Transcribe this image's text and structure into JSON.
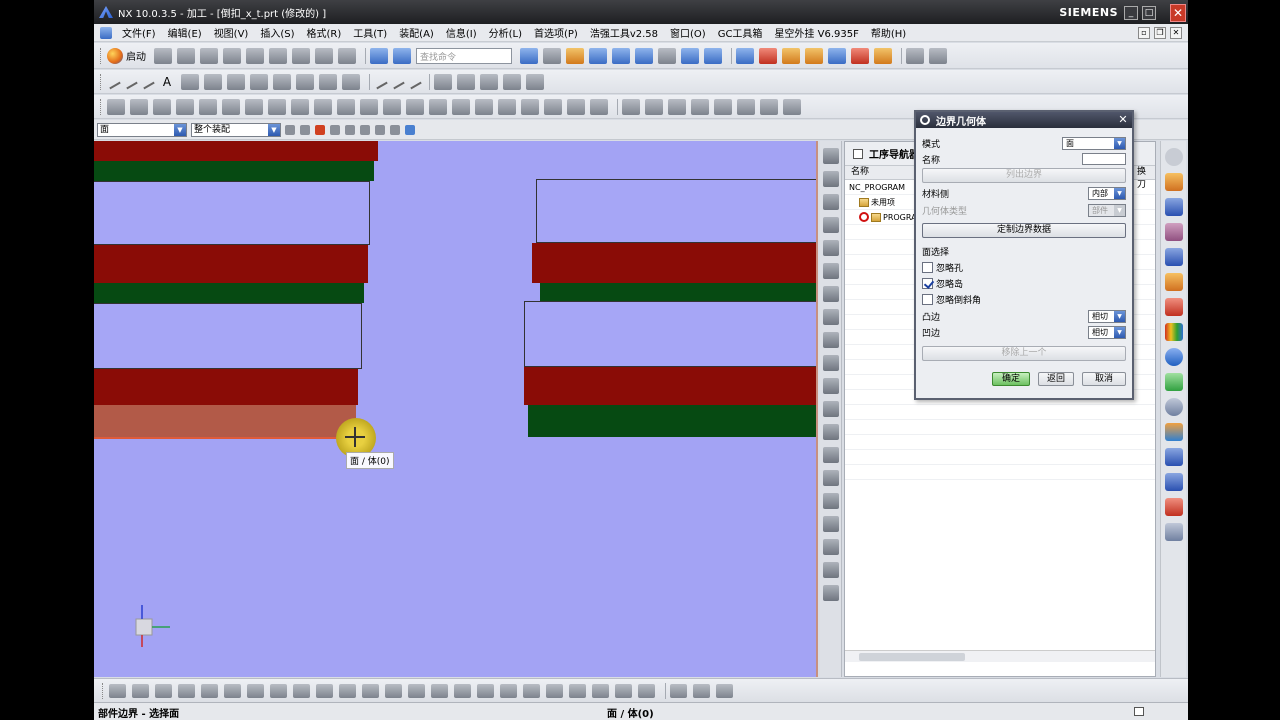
{
  "window": {
    "title": "NX 10.0.3.5 - 加工 - [倒扣_x_t.prt (修改的) ]",
    "brand": "SIEMENS",
    "controls": [
      "minimize-icon",
      "maximize-icon",
      "close-icon"
    ]
  },
  "menu": {
    "items": [
      "文件(F)",
      "编辑(E)",
      "视图(V)",
      "插入(S)",
      "格式(R)",
      "工具(T)",
      "装配(A)",
      "信息(I)",
      "分析(L)",
      "首选项(P)",
      "浩强工具v2.58",
      "窗口(O)",
      "GC工具箱",
      "星空外挂 V6.935F",
      "帮助(H)"
    ]
  },
  "toolbar1": {
    "start_label": "启动",
    "search_placeholder": "查找命令"
  },
  "selection_bar": {
    "filter_value": "面",
    "scope_value": "整个装配"
  },
  "viewport": {
    "background": "#a3a3f4",
    "tooltip": "面 / 体(0)",
    "wcs_axes": [
      "ZC",
      "YC",
      "XC"
    ]
  },
  "navigator": {
    "title": "工序导航器",
    "columns": [
      "名称",
      "换刀"
    ],
    "rows": [
      {
        "label": "NC_PROGRAM",
        "type": "root"
      },
      {
        "label": "未用项",
        "type": "folder"
      },
      {
        "label": "PROGRAM",
        "type": "program-error"
      }
    ]
  },
  "dialog": {
    "title": "边界几何体",
    "mode_label": "模式",
    "mode_value": "面",
    "name_label": "名称",
    "name_value": "",
    "list_boundary_btn": "列出边界",
    "material_side_label": "材料侧",
    "material_side_value": "内部",
    "geometry_type_label": "几何体类型",
    "geometry_type_value": "部件",
    "custom_boundary_btn": "定制边界数据",
    "face_select_label": "面选择",
    "ignore_holes_label": "忽略孔",
    "ignore_holes_checked": false,
    "ignore_islands_label": "忽略岛",
    "ignore_islands_checked": true,
    "ignore_chamfers_label": "忽略倒斜角",
    "ignore_chamfers_checked": false,
    "convex_label": "凸边",
    "convex_value": "相切",
    "concave_label": "凹边",
    "concave_value": "相切",
    "remove_prev_btn": "移除上一个",
    "ok_btn": "确定",
    "back_btn": "返回",
    "cancel_btn": "取消"
  },
  "status": {
    "prompt": "部件边界 - 选择面",
    "selection_info": "面 / 体(0)"
  },
  "colors": {
    "red_face": "#8a0c06",
    "green_face": "#064a12",
    "lavender_face": "#a6a6f6",
    "ok_button": "#6cc060"
  }
}
